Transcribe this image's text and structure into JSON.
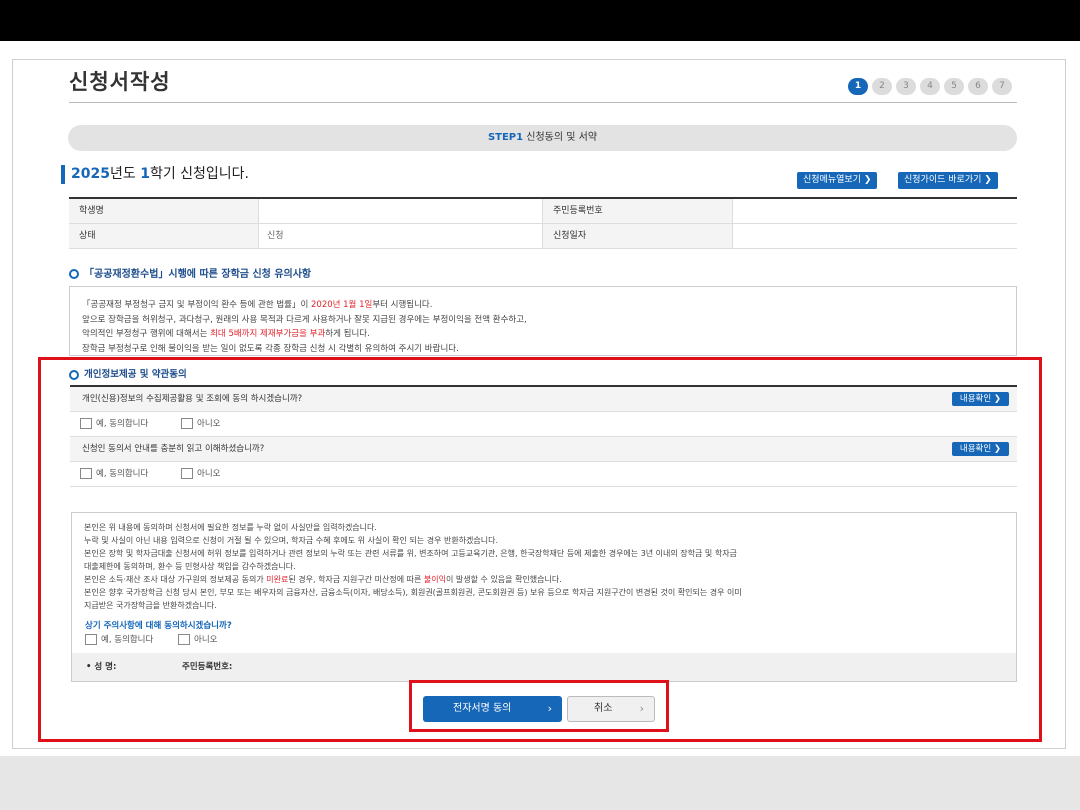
{
  "page": {
    "title": "신청서작성",
    "steps": [
      "1",
      "2",
      "3",
      "4",
      "5",
      "6",
      "7"
    ],
    "active_step": "1",
    "stepbar": {
      "step": "STEP1",
      "label": "신청동의 및 서약"
    }
  },
  "semester": {
    "year": "2025",
    "year_suffix": "년도 ",
    "term": "1",
    "term_suffix": "학기 신청입니다."
  },
  "header_buttons": {
    "menu": "신청메뉴열보기 ❯",
    "guide": "신청가이드 바로가기 ❯"
  },
  "info_table": {
    "row1": {
      "label1": "학생명",
      "value1": "",
      "label2": "주민등록번호",
      "value2": ""
    },
    "row2": {
      "label1": "상태",
      "value1": "신청",
      "label2": "신청일자",
      "value2": ""
    }
  },
  "notice": {
    "title": "「공공재정환수법」시행에 따른 장학금 신청 유의사항",
    "l1_a": "「공공재정 부정청구 금지 및 부정이익 환수 등에 관한 법률」이 ",
    "l1_red": "2020년 1월 1일",
    "l1_b": "부터 시행됩니다.",
    "l2": "앞으로 장학금을 허위청구, 과다청구, 원래의 사용 목적과 다르게 사용하거나 잘못 지급된 경우에는 부정이익을 전액 환수하고,",
    "l3_a": "악의적인 부정청구 행위에 대해서는 ",
    "l3_red": "최대 5배까지 제재부가금을 부과",
    "l3_b": "하게 됩니다.",
    "l4": "장학금 부정청구로 인해 불이익을 받는 일이 없도록 각종 장학금 신청 시 각별히 유의하여 주시기 바랍니다."
  },
  "agreement": {
    "title": "개인정보제공 및 약관동의",
    "q1": "개인(신용)정보의 수집제공활용 및 조회에 동의 하시겠습니까?",
    "q2": "신청인 동의서 안내를 충분히 읽고 이해하셨습니까?",
    "view_btn": "내용확인 ❯",
    "yes": "예, 동의합니다",
    "no": "아니오"
  },
  "consent": {
    "l1": "본인은 위 내용에 동의하며 신청서에 필요한 정보를 누락 없이 사실만을 입력하겠습니다.",
    "l2": "누락 및 사실이 아닌 내용 입력으로 신청이 거절 될 수 있으며, 학자금 수혜 후에도 위 사실이 확인 되는 경우 반환하겠습니다.",
    "l3": "본인은 장학 및 학자금대출 신청서에 허위 정보를 입력하거나 관련 정보의 누락 또는 관련 서류를 위, 변조하여 고등교육기관, 은행, 한국장학재단 등에 제출한 경우에는 3년 이내의 장학금 및 학자금",
    "l4": "대출제한에 동의하며, 환수 등 민형사상 책임을 감수하겠습니다.",
    "l5_a": "본인은 소득·재산 조사 대상 가구원의 정보제공 동의가 ",
    "l5_red1": "미완료",
    "l5_b": "된 경우, 학자금 지원구간 미산정에 따른 ",
    "l5_red2": "불이익",
    "l5_c": "이 발생할 수 있음을 확인했습니다.",
    "l6": "본인은 향후 국가장학금 신청 당시 본인, 부모 또는 배우자의 금융자산, 금융소득(이자, 배당소득), 회원권(골프회원권, 콘도회원권 등) 보유 등으로 학자금 지원구간이 변경된 것이 확인되는 경우 이미",
    "l7": "지급받은 국가장학금을 반환하겠습니다.",
    "question": "상기 주의사항에 대해 동의하시겠습니까?",
    "yes": "예, 동의합니다",
    "no": "아니오",
    "sign_name": "• 성 명:",
    "sign_id": "주민등록번호:"
  },
  "actions": {
    "sign_agree": "전자서명 동의",
    "cancel": "취소"
  },
  "colors": {
    "accent": "#1667b8",
    "highlight_frame": "#e0101a",
    "warning_text": "#e0242b"
  }
}
